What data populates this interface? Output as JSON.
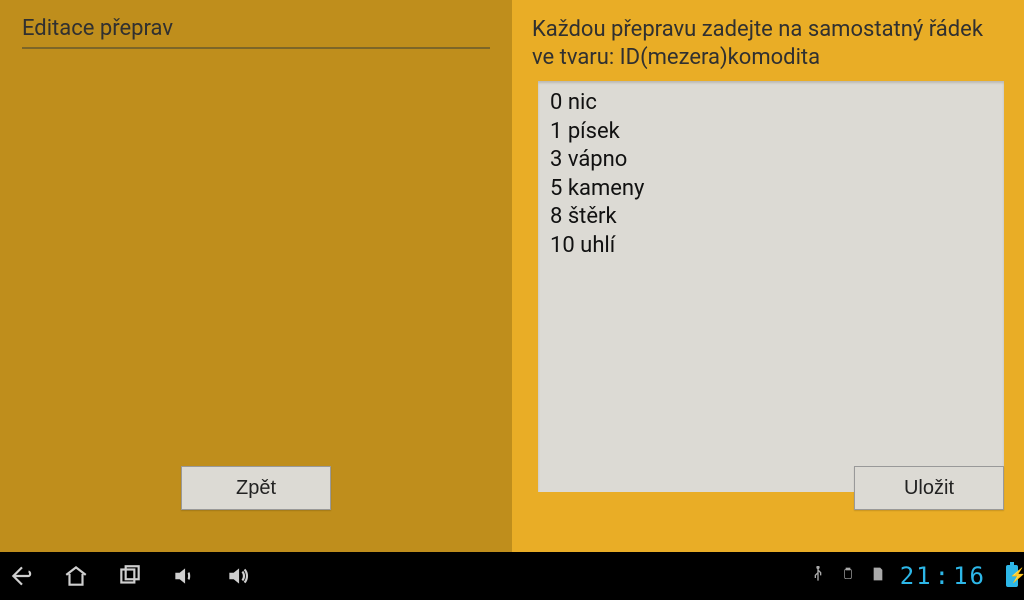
{
  "left": {
    "title": "Editace přeprav",
    "back_label": "Zpět"
  },
  "right": {
    "instruction": "Každou přepravu zadejte na samostatný řádek ve tvaru: ID(mezera)komodita",
    "editor_value": "0 nic\n1 písek\n3 vápno\n5 kameny\n8 štěrk\n10 uhlí",
    "save_label": "Uložit"
  },
  "navbar": {
    "clock_hours": "21",
    "clock_minutes": "16"
  }
}
